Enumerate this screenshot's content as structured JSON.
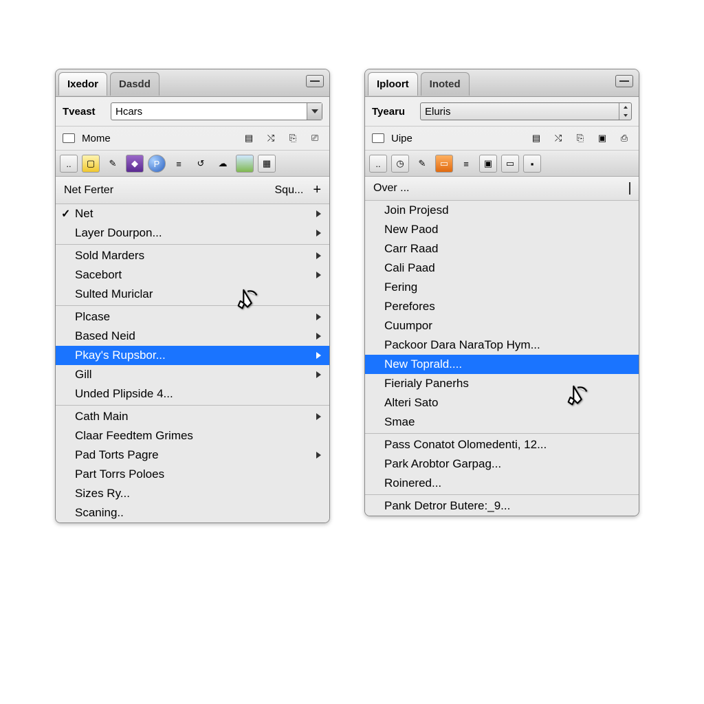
{
  "left": {
    "tabs": [
      "Ixedor",
      "Dasdd"
    ],
    "field_label": "Tveast",
    "field_value": "Hcars",
    "check_label": "Mome",
    "header": {
      "title": "Net Ferter",
      "extra": "Squ..."
    },
    "groups": [
      [
        {
          "label": "Net",
          "checked": true,
          "sub": true
        },
        {
          "label": "Layer Dourpon...",
          "sub": true
        }
      ],
      [
        {
          "label": "Sold Marders",
          "sub": true
        },
        {
          "label": "Sacebort",
          "sub": true
        },
        {
          "label": "Sulted Muriclar"
        }
      ],
      [
        {
          "label": "Plcase",
          "sub": true
        },
        {
          "label": "Based Neid",
          "sub": true
        },
        {
          "label": "Pkay's Rupsbor...",
          "sub": true,
          "selected": true
        },
        {
          "label": "Gill",
          "sub": true
        },
        {
          "label": "Unded Plipside 4..."
        }
      ],
      [
        {
          "label": "Cath Main",
          "sub": true
        },
        {
          "label": "Claar Feedtem Grimes"
        },
        {
          "label": "Pad Torts Pagre",
          "sub": true
        },
        {
          "label": "Part Torrs Poloes"
        },
        {
          "label": "Sizes Ry..."
        },
        {
          "label": "Scaning.."
        }
      ]
    ]
  },
  "right": {
    "tabs": [
      "Iploort",
      "Inoted"
    ],
    "field_label": "Tyearu",
    "field_value": "Eluris",
    "check_label": "Uipe",
    "header": {
      "title": "Over ..."
    },
    "groups": [
      [
        {
          "label": "Join Projesd"
        },
        {
          "label": "New Paod"
        },
        {
          "label": "Carr Raad"
        },
        {
          "label": "Cali Paad"
        },
        {
          "label": "Fering"
        },
        {
          "label": "Perefores"
        },
        {
          "label": "Cuumpor"
        },
        {
          "label": "Packoor Dara NaraTop Hym..."
        },
        {
          "label": "New Toprald....",
          "selected": true
        },
        {
          "label": "Fierialy Panerhs"
        },
        {
          "label": "Alteri Sato"
        },
        {
          "label": "Smae"
        }
      ],
      [
        {
          "label": "Pass Conatot Olomedenti, 12..."
        },
        {
          "label": "Park Arobtor Garpag..."
        },
        {
          "label": "Roinered..."
        }
      ],
      [
        {
          "label": "Pank Detror Butere:_9..."
        }
      ]
    ]
  }
}
